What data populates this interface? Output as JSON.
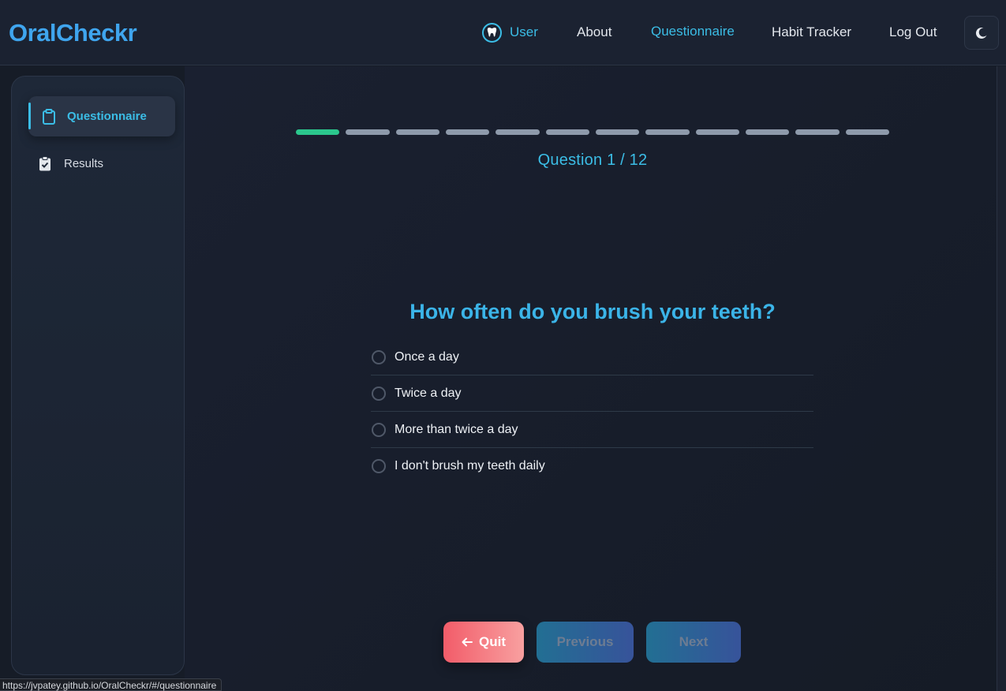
{
  "navbar": {
    "logo": "OralCheckr",
    "user_label": "User",
    "user_icon": "tooth-icon",
    "links": {
      "about": "About",
      "questionnaire": "Questionnaire",
      "habit_tracker": "Habit Tracker",
      "logout": "Log Out"
    },
    "theme_toggle_icon": "moon-icon"
  },
  "sidebar": {
    "items": [
      {
        "label": "Questionnaire",
        "icon": "clipboard-icon",
        "active": true
      },
      {
        "label": "Results",
        "icon": "clipboard-check-icon",
        "active": false
      }
    ]
  },
  "questionnaire": {
    "total_questions": 12,
    "current_question": 1,
    "counter_text": "Question 1 / 12",
    "question": "How often do you brush your teeth?",
    "options": [
      "Once a day",
      "Twice a day",
      "More than twice a day",
      "I don't brush my teeth daily"
    ],
    "selected_option": null
  },
  "buttons": {
    "quit": "Quit",
    "previous": "Previous",
    "next": "Next"
  },
  "status_bar": {
    "url": "https://jvpatey.github.io/OralCheckr/#/questionnaire"
  },
  "colors": {
    "accent": "#3bbde6",
    "progress_done": "#2bc78d",
    "progress_todo": "#8e9aab",
    "quit_start": "#f25c69",
    "nav_button_start": "#226f93"
  }
}
